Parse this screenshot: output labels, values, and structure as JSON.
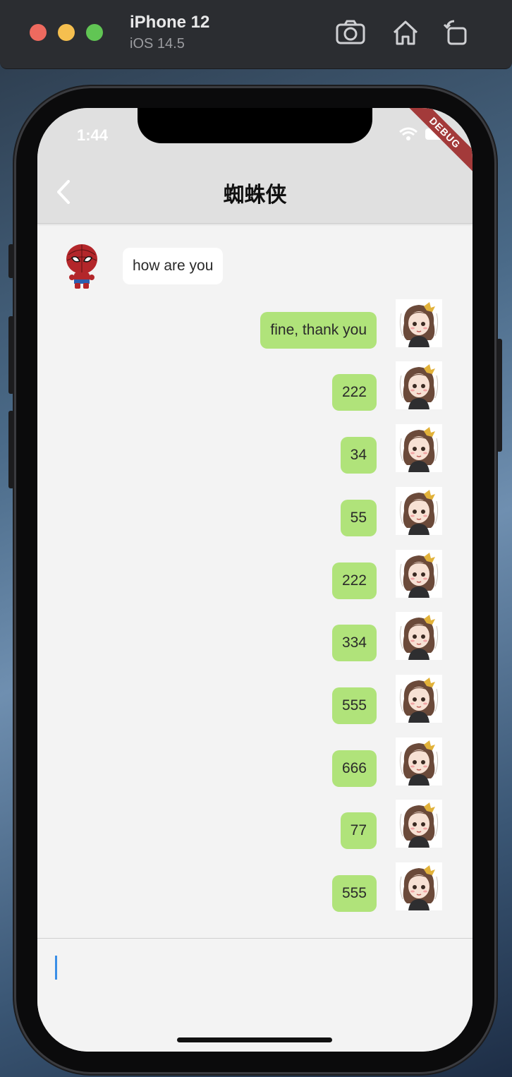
{
  "simulator": {
    "device_name": "iPhone 12",
    "os_version": "iOS 14.5",
    "icons": [
      "screenshot-icon",
      "home-icon",
      "rotate-icon"
    ]
  },
  "statusbar": {
    "time": "1:44",
    "debug_banner": "DEBUG"
  },
  "appbar": {
    "title": "蜘蛛侠",
    "back_icon": "chevron-left-icon"
  },
  "messages": [
    {
      "sender": "other",
      "text": "how are you"
    },
    {
      "sender": "me",
      "text": "fine, thank you"
    },
    {
      "sender": "me",
      "text": "222"
    },
    {
      "sender": "me",
      "text": "34"
    },
    {
      "sender": "me",
      "text": "55"
    },
    {
      "sender": "me",
      "text": "222"
    },
    {
      "sender": "me",
      "text": "334"
    },
    {
      "sender": "me",
      "text": "555"
    },
    {
      "sender": "me",
      "text": "666"
    },
    {
      "sender": "me",
      "text": "77"
    },
    {
      "sender": "me",
      "text": "555"
    }
  ],
  "input": {
    "value": ""
  },
  "colors": {
    "my_bubble": "#b0e37a",
    "other_bubble": "#ffffff",
    "chat_background": "#f3f3f3",
    "appbar_background": "#e0e0e0",
    "cursor": "#3a8ee6"
  }
}
